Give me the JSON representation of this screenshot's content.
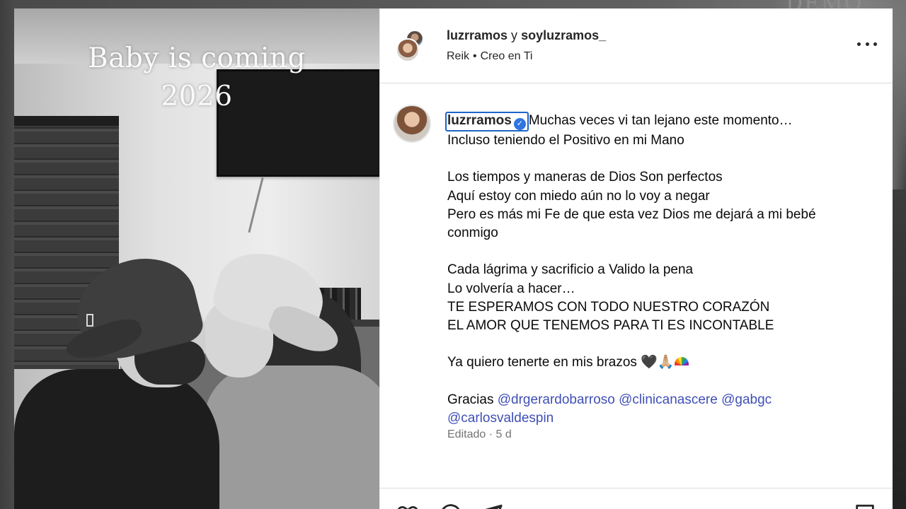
{
  "backdrop": {
    "text": "DEMO REE"
  },
  "post_image": {
    "overlay_line1": "Baby is coming",
    "overlay_line2": "2026"
  },
  "header": {
    "user1": "luzrramos",
    "conjunction": "y",
    "user2": "soyluzramos_",
    "music_artist": "Reik",
    "music_separator": "•",
    "music_track": "Creo en Ti",
    "more_icon": "more-horizontal-icon"
  },
  "caption": {
    "username": "luzrramos",
    "verified_icon": "verified-badge-icon",
    "first_line": "Muchas veces vi tan lejano este momento…",
    "lines": [
      "Incluso teniendo el Positivo en mi Mano",
      "",
      "Los tiempos y maneras de Dios Son perfectos",
      "Aquí estoy con miedo aún no lo voy a negar",
      "Pero es más mi Fe de que esta vez Dios me dejará a mi bebé",
      "conmigo",
      "",
      "Cada lágrima y sacrificio a Valido la pena",
      "Lo volvería a hacer…",
      "TE ESPERAMOS CON TODO NUESTRO CORAZÓN",
      "EL AMOR QUE TENEMOS PARA TI ES INCONTABLE",
      "",
      "Ya quiero tenerte en mis brazos "
    ],
    "emoji_heart": "🖤",
    "emoji_hands": "🙏🏼",
    "emoji_rainbow": "rainbow-emoji",
    "thanks_label": "Gracias",
    "mentions": [
      "@drgerardobarroso",
      "@clinicanascere",
      "@gabgc",
      "@carlosvaldespin"
    ]
  },
  "meta": {
    "edited": "Editado",
    "separator": "·",
    "age": "5 d"
  },
  "actions": {
    "like_icon": "heart-icon",
    "comment_icon": "comment-icon",
    "share_icon": "share-icon",
    "save_icon": "bookmark-icon"
  }
}
